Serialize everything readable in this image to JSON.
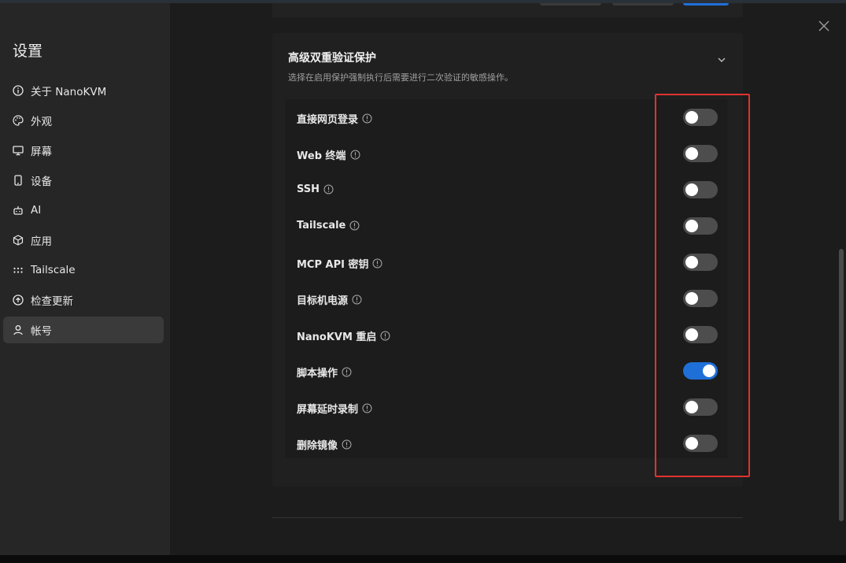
{
  "sidebar": {
    "title": "设置",
    "items": [
      {
        "label": "关于 NanoKVM",
        "icon": "info-icon"
      },
      {
        "label": "外观",
        "icon": "palette-icon"
      },
      {
        "label": "屏幕",
        "icon": "monitor-icon"
      },
      {
        "label": "设备",
        "icon": "smartphone-icon"
      },
      {
        "label": "AI",
        "icon": "bot-icon"
      },
      {
        "label": "应用",
        "icon": "package-icon"
      },
      {
        "label": "Tailscale",
        "icon": "tailscale-icon"
      },
      {
        "label": "检查更新",
        "icon": "arrow-up-circle-icon"
      },
      {
        "label": "帐号",
        "icon": "user-icon",
        "active": true
      }
    ]
  },
  "section": {
    "title": "高级双重验证保护",
    "description": "选择在启用保护强制执行后需要进行二次验证的敏感操作。",
    "expand_icon": "chevron-down-icon"
  },
  "toggles": [
    {
      "label": "直接网页登录",
      "enabled": false
    },
    {
      "label": "Web 终端",
      "enabled": false
    },
    {
      "label": "SSH",
      "enabled": false
    },
    {
      "label": "Tailscale",
      "enabled": false
    },
    {
      "label": "MCP API 密钥",
      "enabled": false
    },
    {
      "label": "目标机电源",
      "enabled": false
    },
    {
      "label": "NanoKVM 重启",
      "enabled": false
    },
    {
      "label": "脚本操作",
      "enabled": true
    },
    {
      "label": "屏幕延时录制",
      "enabled": false
    },
    {
      "label": "删除镜像",
      "enabled": false
    }
  ],
  "colors": {
    "accent": "#1f6fd8",
    "toggle_off": "#4d4d4d",
    "highlight_border": "#e0332f"
  }
}
